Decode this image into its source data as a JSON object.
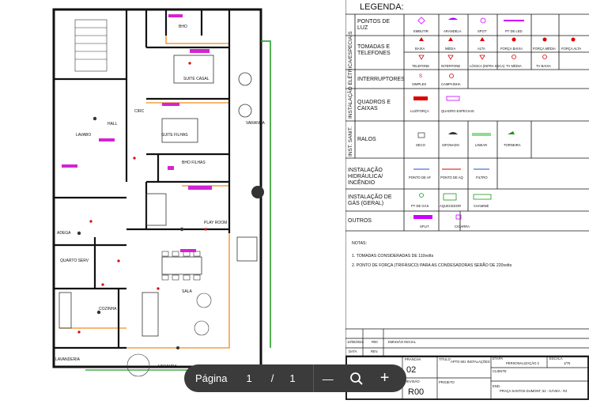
{
  "plan": {
    "rooms": {
      "bho": "BHO",
      "suite_casal": "SUITE CASAL",
      "hall": "HALL",
      "lavabo": "LAVABO",
      "circ": "CIRC",
      "suite_filhas": "SUITE FILHAS",
      "bho_filhas": "BHO FILHAS",
      "varanda": "VARANDA",
      "play_room": "PLAY ROOM",
      "adega": "ADEGA",
      "quarto_serv": "QUARTO SERV",
      "cozinha": "COZINHA",
      "sala": "SALA",
      "varanda_sala": "VARANDA",
      "lavanderia": "LAVANDERIA"
    }
  },
  "legend": {
    "title": "LEGENDA:",
    "side_label_1": "INSTALAÇÃO ELÉTRICA/ESPECIAIS",
    "side_label_2": "INST. SANIT.",
    "sections": {
      "pontos_luz": "PONTOS DE LUZ",
      "tomadas": "TOMADAS E TELEFONES",
      "interruptores": "INTERRUPTORES",
      "quadros": "QUADROS E CAIXAS",
      "ralos": "RALOS",
      "hidraulica": "INSTALAÇÃO HIDRÁULICA/ INCÊNDIO",
      "gas": "INSTALAÇÃO DE GÁS (GERAL)",
      "outros": "OUTROS"
    },
    "items": {
      "embutir": "EMBUTIR",
      "arandela": "ARANDELA",
      "spot": "SPOT",
      "pt_led": "PT DE LED",
      "baixa": "BAIXA",
      "media": "MÉDIA",
      "alta": "ALTA",
      "forca_baixa": "FORÇA BAIXA",
      "forca_media": "FORÇA MÉDIA",
      "forca_alta": "FORÇA ALTA",
      "telefone": "TELEFONE",
      "interfone": "INTERFONE",
      "logica": "LÓGICA (INFRA SECA)",
      "tv_media": "TV MÉDIA",
      "tv_baixa": "TV BAIXA",
      "simples": "SIMPLES",
      "campainha": "CAMPAINHA",
      "luz_forca": "LUZ/FORÇA",
      "quadro_especiais": "QUADRO ESPECIAIS",
      "seco": "SECO",
      "sifonado": "SIFONADO",
      "linear": "LINEAR",
      "torneira": "TORNEIRA",
      "ponto_af": "PONTO DE AF",
      "ponto_aq": "PONTO DE AQ",
      "filtro": "FILTRO",
      "pt_gas": "PT DE GÁS",
      "aquecedor": "AQUECEDOR",
      "chamine": "CHAMINÉ",
      "split": "SPLIT",
      "cigarra": "CIGARRA"
    },
    "notes_title": "NOTAS:",
    "note_1": "1. TOMADAS CONSIDERADAS DE 110volts",
    "note_2": "2. PONTO DE FORÇA (TRIFÁSICO) PARA AS CONDESADORAS SERÃO DE 220volts"
  },
  "titleblock": {
    "date": "10/05/2022",
    "rev_code": "R00",
    "emission": "EMISSÃO INICIAL",
    "col_data": "DATA",
    "col_rev": "REV.",
    "prancha_label": "PRANCHA",
    "prancha": "02",
    "revisao_label": "REVISÃO",
    "revisao": "R00",
    "titulo_label": "TÍTULO",
    "titulo": "APTO 601 INSTALAÇÕES",
    "projeto_label": "PROJETO",
    "etapa_label": "ETAPA",
    "etapa": "PERSONALIZAÇÃO 2",
    "escala_label": "ESCALA",
    "escala": "1/75",
    "cliente_label": "CLIENTE",
    "end_label": "END.",
    "endereco": "PRAÇA SANTOS DUMONT, 52 - GÁVEA - RJ"
  },
  "toolbar": {
    "page_label": "Página",
    "current_page": "1",
    "separator": "/",
    "total_pages": "1",
    "zoom_out": "—",
    "zoom_in": "+"
  }
}
